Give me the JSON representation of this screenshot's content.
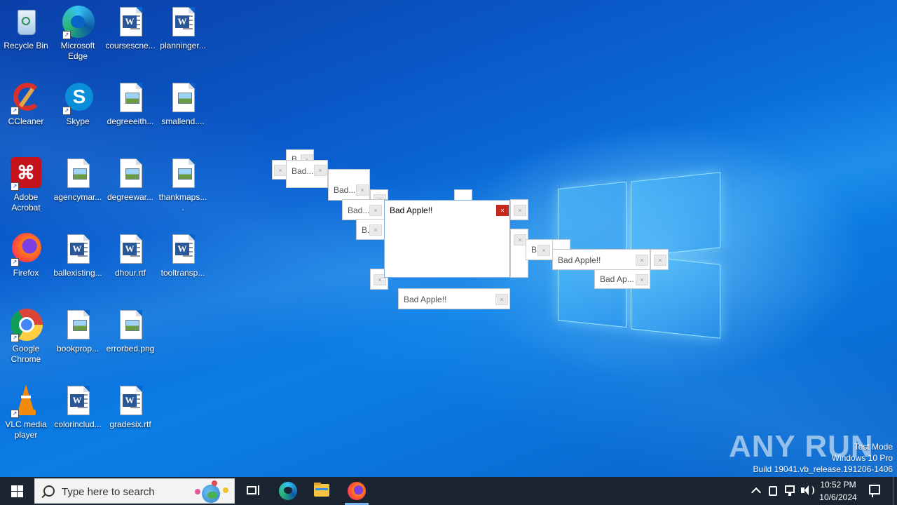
{
  "desktop": {
    "icons": [
      {
        "label": "Recycle Bin",
        "icon": "recycle-bin-icon"
      },
      {
        "label": "Microsoft Edge",
        "icon": "edge-icon"
      },
      {
        "label": "coursescne...",
        "icon": "word-doc-icon"
      },
      {
        "label": "planninger...",
        "icon": "word-doc-icon"
      },
      {
        "label": "CCleaner",
        "icon": "ccleaner-icon"
      },
      {
        "label": "Skype",
        "icon": "skype-icon"
      },
      {
        "label": "degreeeith...",
        "icon": "image-file-icon"
      },
      {
        "label": "smallend....",
        "icon": "image-file-icon"
      },
      {
        "label": "Adobe Acrobat",
        "icon": "acrobat-icon"
      },
      {
        "label": "agencymar...",
        "icon": "image-file-icon"
      },
      {
        "label": "degreewar...",
        "icon": "image-file-icon"
      },
      {
        "label": "thankmaps....",
        "icon": "image-file-icon"
      },
      {
        "label": "Firefox",
        "icon": "firefox-icon"
      },
      {
        "label": "ballexisting...",
        "icon": "word-doc-icon"
      },
      {
        "label": "dhour.rtf",
        "icon": "word-doc-icon"
      },
      {
        "label": "tooltransp...",
        "icon": "word-doc-icon"
      },
      {
        "label": "Google Chrome",
        "icon": "chrome-icon"
      },
      {
        "label": "bookprop...",
        "icon": "image-file-icon"
      },
      {
        "label": "errorbed.png",
        "icon": "image-file-icon"
      },
      {
        "label": "VLC media player",
        "icon": "vlc-icon"
      },
      {
        "label": "colorinclud...",
        "icon": "word-doc-icon"
      },
      {
        "label": "gradesix.rtf",
        "icon": "word-doc-icon"
      }
    ]
  },
  "popups": {
    "main_title": "Bad Apple!!",
    "close_glyph": "×",
    "small": [
      "B",
      "Bad...",
      "Bad...",
      "Bad...",
      "B.",
      "B.",
      "Bad Apple!!",
      "Bad Ap...",
      "Bad Apple!!"
    ]
  },
  "taskbar": {
    "search_placeholder": "Type here to search",
    "time": "10:52 PM",
    "date": "10/6/2024",
    "pinned": [
      "task-view-icon",
      "edge-icon",
      "file-explorer-icon",
      "firefox-icon"
    ]
  },
  "watermark": {
    "line1": "Test Mode",
    "line2": "Windows 10 Pro",
    "line3": "Build 19041.vb_release.191206-1406",
    "brand": "ANY RUN"
  },
  "colors": {
    "accent": "#0a63c9",
    "taskbar": "#1b2431",
    "close_red": "#c42b1c"
  }
}
